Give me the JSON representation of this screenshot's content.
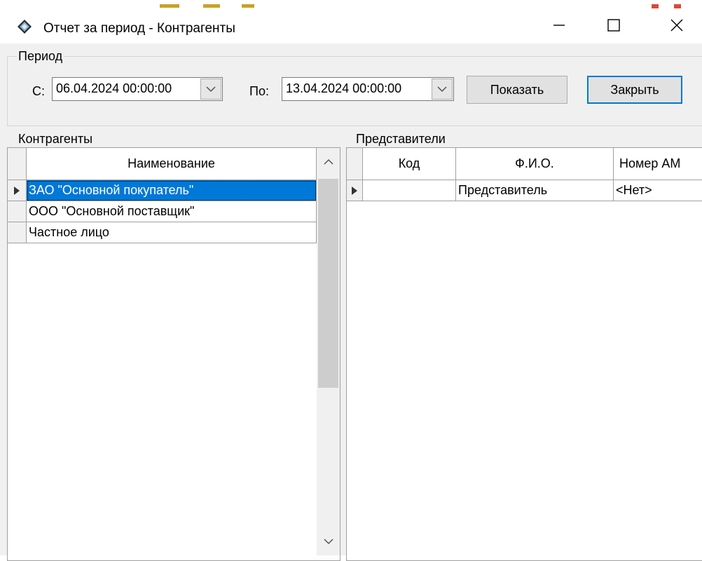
{
  "window": {
    "title": "Отчет за период - Контрагенты",
    "icon": "app-diamond-icon",
    "controls": {
      "minimize": "—",
      "maximize": "☐",
      "close": "✕"
    }
  },
  "period": {
    "legend": "Период",
    "from_label": "С:",
    "from_value": "06.04.2024 00:00:00",
    "to_label": "По:",
    "to_value": "13.04.2024 00:00:00",
    "show_button": "Показать",
    "close_button": "Закрыть"
  },
  "counterparties": {
    "legend": "Контрагенты",
    "columns": [
      "Наименование"
    ],
    "rows": [
      {
        "name": "ЗАО \"Основной покупатель\"",
        "selected": true
      },
      {
        "name": "ООО \"Основной поставщик\"",
        "selected": false
      },
      {
        "name": "Частное лицо",
        "selected": false
      }
    ]
  },
  "representatives": {
    "legend": "Представители",
    "columns": [
      "Код",
      "Ф.И.О.",
      "Номер АМ"
    ],
    "rows": [
      {
        "code": "",
        "fio": "Представитель",
        "am": "<Нет>"
      }
    ]
  },
  "colors": {
    "accent": "#0078d7",
    "dialog_bg": "#f0f0f0",
    "grid_line": "#a0a0a0"
  }
}
